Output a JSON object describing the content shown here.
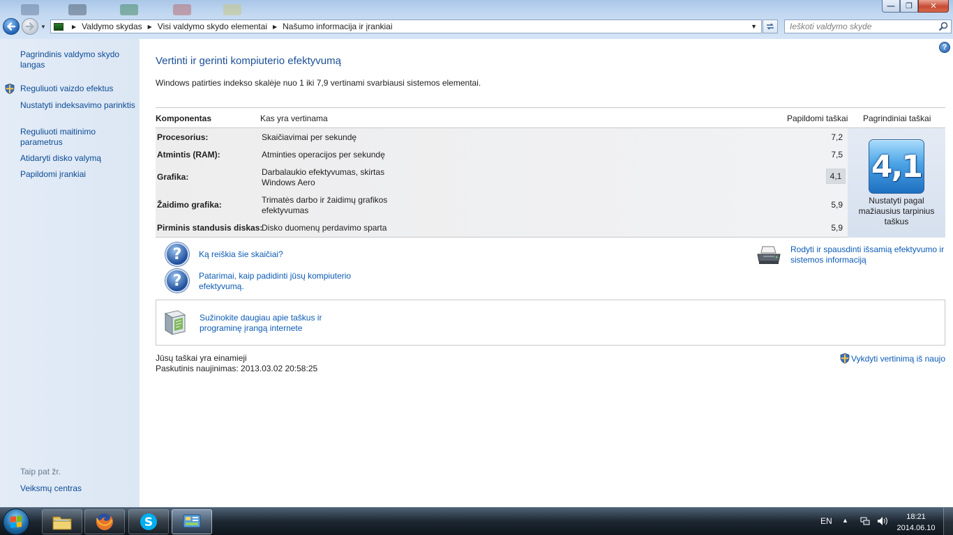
{
  "window": {
    "controls": {
      "minimize": "—",
      "maximize": "❐",
      "close": "✕"
    }
  },
  "nav": {
    "breadcrumbs": [
      "Valdymo skydas",
      "Visi valdymo skydo elementai",
      "Našumo informacija ir įrankiai"
    ],
    "search_placeholder": "Ieškoti valdymo skyde"
  },
  "sidebar": {
    "items": [
      {
        "label": "Pagrindinis valdymo skydo langas",
        "shield": false
      },
      {
        "label": "Reguliuoti vaizdo efektus",
        "shield": true
      },
      {
        "label": "Nustatyti indeksavimo parinktis",
        "shield": false
      },
      {
        "label": "Reguliuoti maitinimo parametrus",
        "shield": false
      },
      {
        "label": "Atidaryti disko valymą",
        "shield": false
      },
      {
        "label": "Papildomi įrankiai",
        "shield": false
      }
    ],
    "see_also_title": "Taip pat žr.",
    "see_also_items": [
      "Veiksmų centras"
    ]
  },
  "main": {
    "title": "Vertinti ir gerinti kompiuterio efektyvumą",
    "description": "Windows patirties indekso skalėje nuo 1 iki 7,9 vertinami svarbiausi sistemos elementai.",
    "table": {
      "headers": {
        "component": "Komponentas",
        "what": "Kas yra vertinama",
        "subscore": "Papildomi taškai",
        "basescore": "Pagrindiniai taškai"
      },
      "rows": [
        {
          "component": "Procesorius:",
          "description": "Skaičiavimai per sekundę",
          "score": "7,2"
        },
        {
          "component": "Atmintis (RAM):",
          "description": "Atminties operacijos per sekundę",
          "score": "7,5"
        },
        {
          "component": "Grafika:",
          "description": "Darbalaukio efektyvumas, skirtas Windows Aero",
          "score": "4,1",
          "lowest": true
        },
        {
          "component": "Žaidimo grafika:",
          "description": "Trimatės darbo ir žaidimų grafikos efektyvumas",
          "score": "5,9"
        },
        {
          "component": "Pirminis standusis diskas:",
          "description": "Disko duomenų perdavimo sparta",
          "score": "5,9"
        }
      ],
      "base_score": "4,1",
      "base_caption": "Nustatyti pagal mažiausius tarpinius taškus"
    },
    "links": {
      "what_mean": "Ką reiškia šie skaičiai?",
      "tips": "Patarimai, kaip padidinti jūsų kompiuterio efektyvumą.",
      "print_details": "Rodyti ir spausdinti išsamią efektyvumo ir sistemos informaciją",
      "learn_more": "Sužinokite daugiau apie taškus ir programinę įrangą internete"
    },
    "status": {
      "current": "Jūsų taškai yra einamieji",
      "last_update": "Paskutinis naujinimas: 2013.03.02 20:58:25"
    },
    "rerun_label": "Vykdyti vertinimą iš naujo"
  },
  "taskbar": {
    "apps": [
      "windows-explorer-icon",
      "firefox-icon",
      "skype-icon",
      "control-panel-icon"
    ],
    "language": "EN",
    "time": "18:21",
    "date": "2014.06.10"
  },
  "colors": {
    "link": "#0b5bb5",
    "title": "#1c4f96",
    "sidebar_bg": "#e3ecf7",
    "badge": "#1e6fc0"
  }
}
